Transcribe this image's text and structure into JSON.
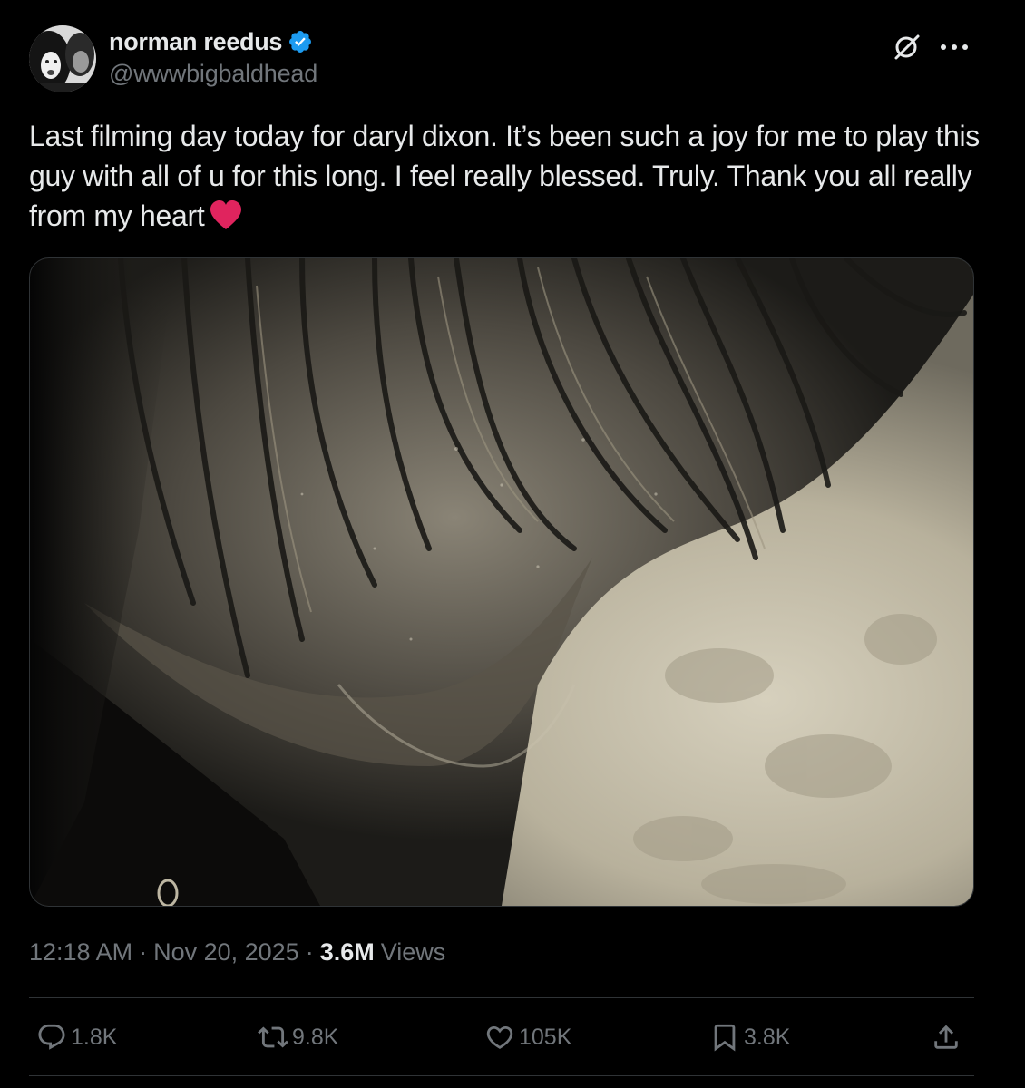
{
  "author": {
    "display_name": "norman reedus",
    "handle": "@wwwbigbaldhead",
    "verified": true
  },
  "tweet": {
    "text": "Last filming day today for daryl dixon. It’s been such a joy for me to play this guy with all of u for this long. I feel really blessed. Truly. Thank you all really from my heart",
    "emoji": "red-heart"
  },
  "meta": {
    "time": "12:18 AM",
    "separator": "·",
    "date": "Nov 20, 2025",
    "views_count": "3.6M",
    "views_label": "Views"
  },
  "actions": {
    "replies": "1.8K",
    "reposts": "9.8K",
    "likes": "105K",
    "bookmarks": "3.8K"
  },
  "icons": {
    "grok": "grok-icon",
    "more": "more-icon",
    "reply": "reply-icon",
    "repost": "repost-icon",
    "like": "like-icon",
    "bookmark": "bookmark-icon",
    "share": "share-icon"
  },
  "colors": {
    "background": "#000000",
    "text": "#e7e9ea",
    "secondary": "#71767b",
    "verified": "#1d9bf0",
    "heart": "#e0245e",
    "divider": "#2f3336"
  }
}
